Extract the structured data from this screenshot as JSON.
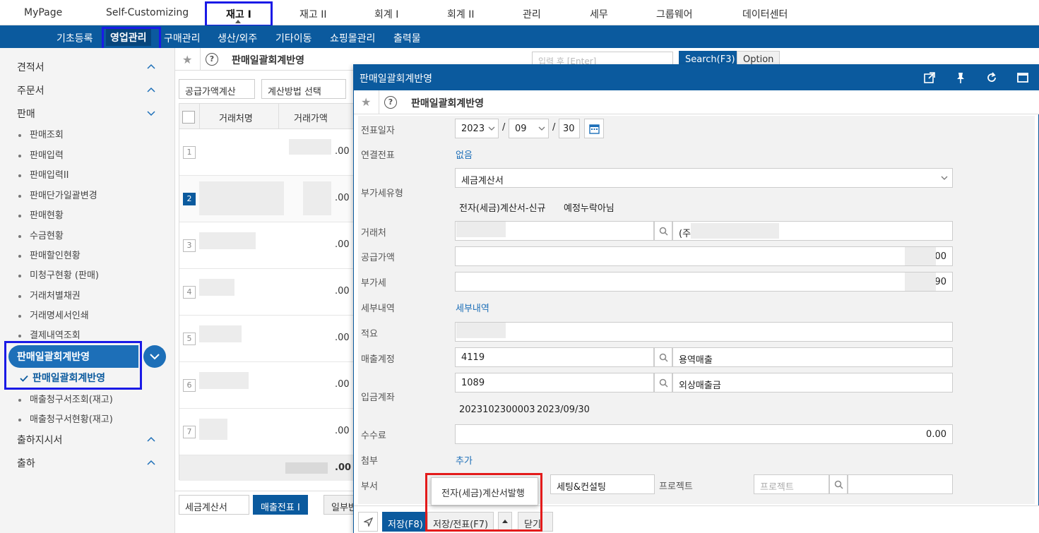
{
  "topnav": {
    "items": [
      "MyPage",
      "Self-Customizing",
      "재고 I",
      "재고 II",
      "회계 I",
      "회계 II",
      "관리",
      "세무",
      "그룹웨어",
      "데이터센터"
    ]
  },
  "subnav": {
    "items": [
      "기초등록",
      "영업관리",
      "구매관리",
      "생산/외주",
      "기타이동",
      "쇼핑몰관리",
      "출력물"
    ]
  },
  "sidebar": {
    "groups_top": [
      "견적서",
      "주문서",
      "판매"
    ],
    "sales_items": [
      "판매조회",
      "판매입력",
      "판매입력II",
      "판매단가일괄변경",
      "판매현황",
      "수금현황",
      "판매할인현황",
      "미청구현황 (판매)",
      "거래처별채권",
      "거래명세서인쇄",
      "결제내역조회"
    ],
    "active_group": "판매일괄회계반영",
    "active_item": "판매일괄회계반영",
    "after_items": [
      "매출청구서조회(재고)",
      "매출청구서현황(재고)"
    ],
    "groups_bottom": [
      "출하지시서",
      "출하"
    ]
  },
  "main": {
    "title": "판매일괄회계반영",
    "search_placeholder": "입력 후 [Enter]",
    "search_button": "Search(F3)",
    "option_button": "Option",
    "select1": "공급가액계산",
    "select2": "계산방법 선택",
    "col_customer": "거래처명",
    "col_amount": "거래가액",
    "row_numbers": [
      "1",
      "2",
      "3",
      "4",
      "5",
      "6",
      "7"
    ],
    "row_amount_suffixes": [
      ".00",
      ".00",
      ".00",
      ".00",
      ".00",
      ".00",
      ".00"
    ],
    "total_suffix": ".00",
    "bottom_select": "세금계산서",
    "bottom_button": "매출전표 I",
    "bottom_partial": "일부반"
  },
  "panel": {
    "window_title": "판매일괄회계반영",
    "title": "판매일괄회계반영",
    "labels": {
      "date": "전표일자",
      "linked": "연결전표",
      "vat_type": "부가세유형",
      "customer": "거래처",
      "supply": "공급가액",
      "vat": "부가세",
      "tax_detail": "세부내역",
      "summary": "적요",
      "sales_account": "매출계정",
      "deposit_account": "입금계좌",
      "fee": "수수료",
      "attach": "첨부",
      "dept": "부서",
      "project": "프로젝트"
    },
    "date": {
      "year": "2023",
      "month": "09",
      "day": "30",
      "sep": "/"
    },
    "linked_value": "없음",
    "vat_type_value": "세금계산서",
    "vat_sub1": "전자(세금)계산서-신규",
    "vat_sub2": "예정누락아님",
    "customer_name_prefix": "(주",
    "supply_suffix": ".00",
    "vat_suffix": ".90",
    "tax_detail_link": "세부내역",
    "sales_account_code": "4119",
    "sales_account_name": "용역매출",
    "deposit_code": "1089",
    "deposit_name": "외상매출금",
    "deposit_ref": "2023102300003",
    "deposit_date": "2023/09/30",
    "fee_value": "0.00",
    "attach_link": "추가",
    "dept_value": "세팅&컨설팅",
    "project_placeholder": "프로젝트",
    "footer": {
      "save": "저장(F8)",
      "save_slip": "저장/전표(F7)",
      "close": "닫기"
    },
    "popup_item": "전자(세금)계산서발행"
  },
  "colors": {
    "brand": "#0b5a9e",
    "highlight_blue": "#1a1ae6",
    "highlight_red": "#e31b1b"
  }
}
